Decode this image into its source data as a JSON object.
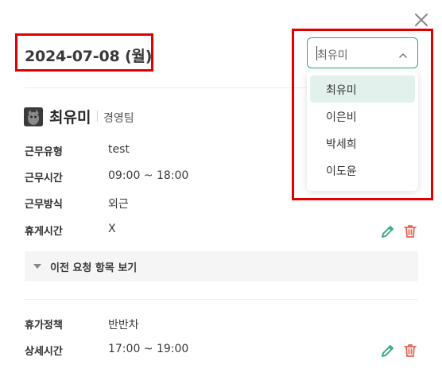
{
  "header": {
    "date": "2024-07-08 (월)"
  },
  "profile": {
    "name": "최유미",
    "team": "경영팀"
  },
  "work": {
    "rows": [
      {
        "label": "근무유형",
        "value": "test"
      },
      {
        "label": "근무시간",
        "value": "09:00 ~ 18:00"
      },
      {
        "label": "근무방식",
        "value": "외근"
      },
      {
        "label": "휴게시간",
        "value": "X"
      }
    ]
  },
  "history": {
    "label": "이전 요청 항목 보기"
  },
  "leave": {
    "rows": [
      {
        "label": "휴가정책",
        "value": "반반차"
      },
      {
        "label": "상세시간",
        "value": "17:00 ~ 19:00"
      }
    ]
  },
  "selector": {
    "value": "최유미",
    "options": [
      "최유미",
      "이은비",
      "박세희",
      "이도윤"
    ],
    "selected_index": 0
  },
  "colors": {
    "accent": "#2fa67a",
    "edit": "#2fa67a",
    "delete": "#e8614f",
    "highlight_box": "#e00000"
  },
  "icons": {
    "close": "close-icon",
    "chevron": "chevron-up-icon",
    "edit": "pencil-icon",
    "delete": "trash-icon",
    "expand": "caret-down-icon"
  }
}
